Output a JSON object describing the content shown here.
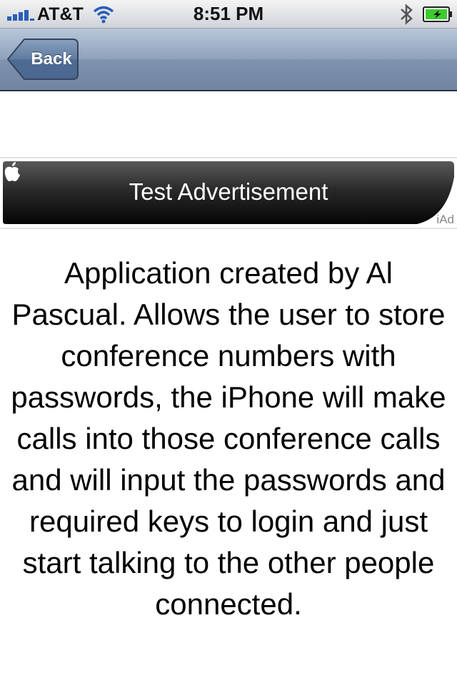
{
  "status_bar": {
    "carrier": "AT&T",
    "time": "8:51 PM",
    "icons": [
      "signal-icon",
      "wifi-icon",
      "bluetooth-icon",
      "battery-charging-icon"
    ],
    "battery_color": "#3ccc2e"
  },
  "nav": {
    "back_label": "Back",
    "bar_color": "#7e93ae"
  },
  "ad": {
    "label": "Test Advertisement",
    "badge": "iAd",
    "icon": "apple-icon"
  },
  "content": {
    "description": "Application created by Al Pascual. Allows the user to store conference numbers with passwords, the iPhone will make calls into those conference calls and will input the passwords and required keys to login and just start talking to the other people connected."
  }
}
